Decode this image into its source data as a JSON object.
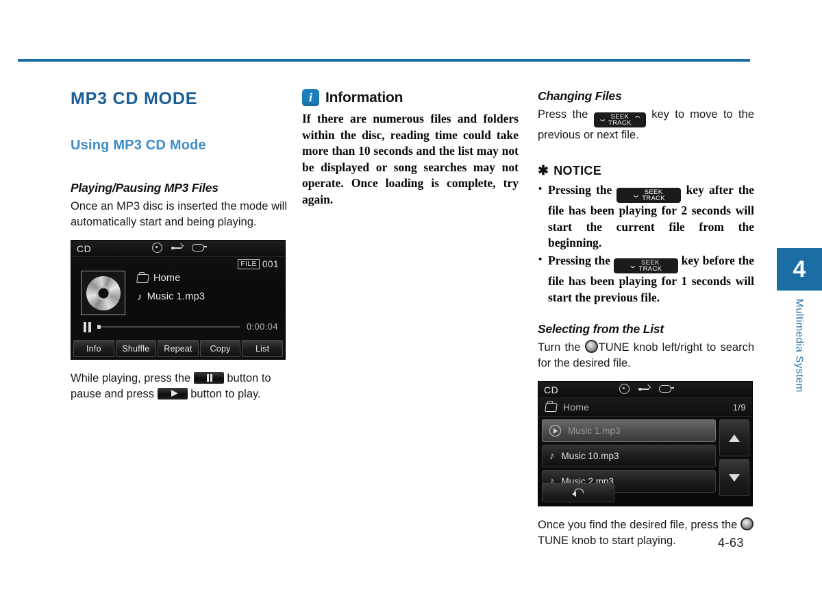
{
  "page": {
    "number": "4-63",
    "side_tab_chapter": "4",
    "side_tab_label": "Multimedia System",
    "accent_color": "#1b6ea4",
    "heading_color": "#1a5e96",
    "subheading_color": "#3e8cc6"
  },
  "left_column": {
    "chapter_title": "MP3 CD MODE",
    "section_title": "Using MP3 CD Mode",
    "sub_title": "Playing/Pausing MP3 Files",
    "intro_paragraph": "Once an MP3 disc is inserted the mode will automatically start and being playing.",
    "caption_part1": "While playing, press the",
    "caption_part2": "button to pause and press",
    "caption_part3": "button to play."
  },
  "now_playing_screen": {
    "source_label": "CD",
    "status_icons": [
      "disc-icon",
      "usb-icon",
      "aux-icon"
    ],
    "file_tag": "FILE",
    "file_number": "001",
    "folder_name": "Home",
    "track_name": "Music 1.mp3",
    "playback_state": "paused",
    "elapsed_time": "0:00:04",
    "softkeys": [
      "Info",
      "Shuffle",
      "Repeat",
      "Copy",
      "List"
    ]
  },
  "middle_column": {
    "info_title": "Information",
    "info_icon": "i",
    "info_body": "If there are numerous files and folders within the disc, reading time could take more than 10 seconds and the list may not be displayed or song searches may not operate. Once loading is complete, try again."
  },
  "right_column": {
    "changing_files_title": "Changing Files",
    "changing_files_part1": "Press the",
    "changing_files_part2": "key to move to the previous or next file.",
    "notice_star": "✱",
    "notice_title": "NOTICE",
    "notice_items": [
      {
        "part1": "Pressing the",
        "part2": "key after the file has been playing for 2 seconds will start the current file from the beginning."
      },
      {
        "part1": "Pressing the",
        "part2": "key before the file has been playing for 1 seconds will start the previous file."
      }
    ],
    "selecting_title": "Selecting from the List",
    "selecting_part1": "Turn the",
    "selecting_part2": "TUNE knob left/right to search for the desired file.",
    "closing_part1": "Once you find the desired file, press the",
    "closing_part2": "TUNE knob to start playing."
  },
  "seek_key": {
    "label_top": "SEEK",
    "label_bottom": "TRACK",
    "chevron_down": "⌄",
    "chevron_up": "⌃"
  },
  "list_screen": {
    "source_label": "CD",
    "status_icons": [
      "disc-icon",
      "usb-icon",
      "aux-icon"
    ],
    "folder_name": "Home",
    "page_indicator": "1/9",
    "rows": [
      {
        "label": "Music 1.mp3",
        "icon": "play-circle-icon",
        "selected": true
      },
      {
        "label": "Music 10.mp3",
        "icon": "music-note-icon",
        "selected": false
      },
      {
        "label": "Music 2.mp3",
        "icon": "music-note-icon",
        "selected": false
      }
    ],
    "scroll_up": "▲",
    "scroll_down": "▼",
    "back_button": "back-arrow-icon"
  },
  "glyphs": {
    "music_note": "♪",
    "arrow_up": "▲",
    "arrow_down": "▼"
  }
}
